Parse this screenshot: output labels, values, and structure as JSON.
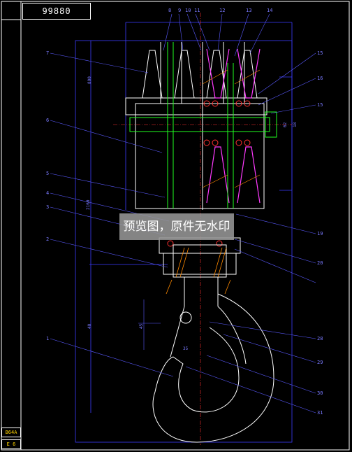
{
  "drawing": {
    "title_block": "99880",
    "scale_top": "B64A",
    "scale_bottom": "E 6",
    "watermark": "预览图，原件无水印"
  },
  "top_part_numbers": [
    "8",
    "9",
    "10",
    "11",
    "12",
    "13",
    "14"
  ],
  "left_part_numbers": [
    "7",
    "6",
    "5",
    "4",
    "3",
    "2",
    "1"
  ],
  "right_part_numbers": [
    "15",
    "16",
    "15",
    "19",
    "20",
    "28",
    "29",
    "30",
    "31"
  ],
  "dimensions": [
    "2160",
    "800",
    "45",
    "62",
    "18",
    "35",
    "40"
  ]
}
